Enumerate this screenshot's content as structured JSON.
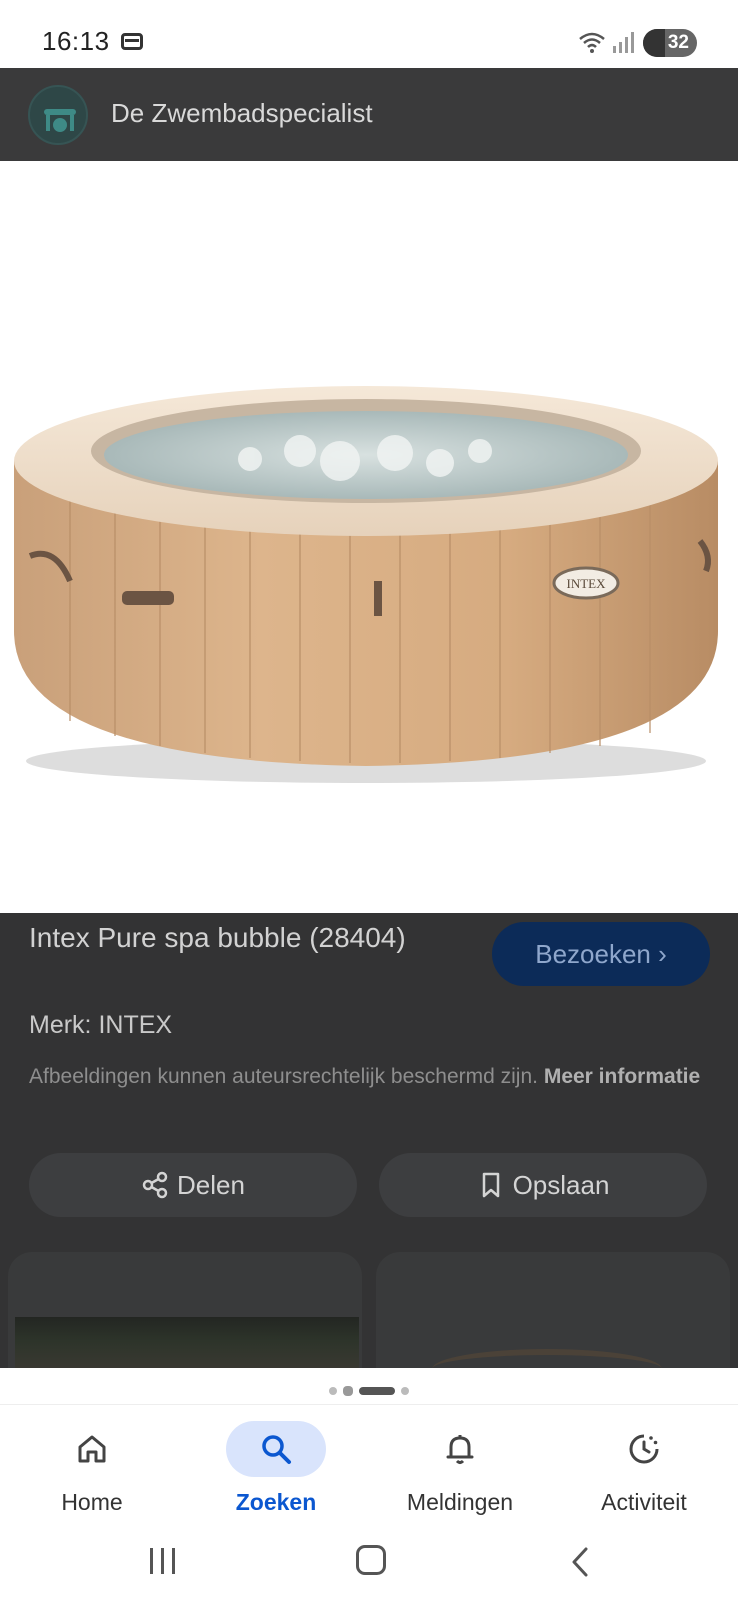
{
  "status_bar": {
    "time": "16:13",
    "battery": "32"
  },
  "header": {
    "site_name": "De Zwembadspecialist"
  },
  "hero": {
    "image_alt": "Intex opblaasbare spa",
    "brand_print": "INTEX"
  },
  "product": {
    "title": "Intex Pure spa bubble (28404)",
    "brand": "Merk: INTEX",
    "copyright_text": "Afbeeldingen kunnen auteursrechtelijk beschermd zijn.",
    "more_info_link": "Meer informatie"
  },
  "buttons": {
    "visit": "Bezoeken ›",
    "share": "Delen",
    "save": "Opslaan"
  },
  "carousel": {
    "dot_count": 4,
    "active_index": 2
  },
  "bottom_nav": {
    "items": [
      {
        "label": "Home",
        "icon": "home-icon"
      },
      {
        "label": "Zoeken",
        "icon": "search-icon",
        "active": true
      },
      {
        "label": "Meldingen",
        "icon": "bell-icon"
      },
      {
        "label": "Activiteit",
        "icon": "activity-icon"
      }
    ]
  },
  "colors": {
    "accent": "#0b57d0",
    "active_nav_bg": "#d9e4fc",
    "dim_bg": "#333334",
    "visit_button_bg": "#0c2b58"
  }
}
